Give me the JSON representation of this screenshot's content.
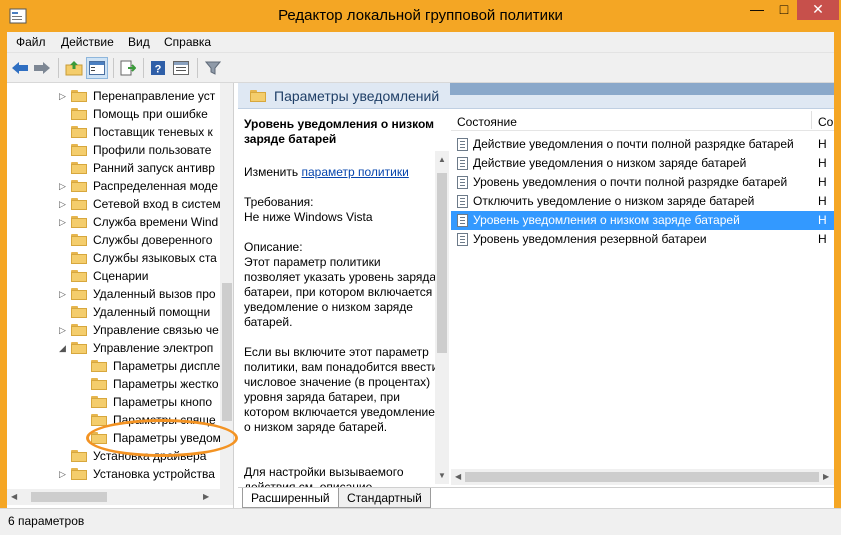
{
  "window": {
    "title": "Редактор локальной групповой политики",
    "controls": {
      "minimize": "—",
      "maximize": "□",
      "close": "✕"
    }
  },
  "menu": [
    "Файл",
    "Действие",
    "Вид",
    "Справка"
  ],
  "toolbar": {
    "buttons": [
      "back-icon",
      "forward-icon",
      "up-folder-icon",
      "show-hide-tree-icon",
      "export-list-icon",
      "help-icon",
      "properties-icon",
      "filter-icon"
    ]
  },
  "tree": {
    "items": [
      {
        "label": "Перенаправление уст",
        "indent": 1,
        "arrow": "▷"
      },
      {
        "label": "Помощь при ошибке",
        "indent": 1,
        "arrow": ""
      },
      {
        "label": "Поставщик теневых к",
        "indent": 1,
        "arrow": ""
      },
      {
        "label": "Профили пользовате",
        "indent": 1,
        "arrow": ""
      },
      {
        "label": "Ранний запуск антивр",
        "indent": 1,
        "arrow": ""
      },
      {
        "label": "Распределенная моде",
        "indent": 1,
        "arrow": "▷"
      },
      {
        "label": "Сетевой вход в систем",
        "indent": 1,
        "arrow": "▷"
      },
      {
        "label": "Служба времени Wind",
        "indent": 1,
        "arrow": "▷"
      },
      {
        "label": "Службы доверенного",
        "indent": 1,
        "arrow": ""
      },
      {
        "label": "Службы языковых ста",
        "indent": 1,
        "arrow": ""
      },
      {
        "label": "Сценарии",
        "indent": 1,
        "arrow": ""
      },
      {
        "label": "Удаленный вызов про",
        "indent": 1,
        "arrow": "▷"
      },
      {
        "label": "Удаленный помощни",
        "indent": 1,
        "arrow": ""
      },
      {
        "label": "Управление связью че",
        "indent": 1,
        "arrow": "▷"
      },
      {
        "label": "Управление электроп",
        "indent": 1,
        "arrow": "◢"
      },
      {
        "label": "Параметры диспле",
        "indent": 2,
        "arrow": ""
      },
      {
        "label": "Параметры жестко",
        "indent": 2,
        "arrow": ""
      },
      {
        "label": "Параметры кнопо",
        "indent": 2,
        "arrow": ""
      },
      {
        "label": "Параметры спяще",
        "indent": 2,
        "arrow": ""
      },
      {
        "label": "Параметры уведом",
        "indent": 2,
        "arrow": ""
      },
      {
        "label": "Установка драйвера",
        "indent": 1,
        "arrow": ""
      },
      {
        "label": "Установка устройства",
        "indent": 1,
        "arrow": "▷"
      }
    ]
  },
  "header": {
    "title": "Параметры уведомлений"
  },
  "description": {
    "title": "Уровень уведомления о низком заряде батарей",
    "edit_prefix": "Изменить ",
    "edit_link": "параметр политики",
    "requirements": "Требования:\nНе ниже Windows Vista",
    "desc_label": "Описание:",
    "desc_text": "Этот параметр политики позволяет указать уровень заряда батареи, при котором включается уведомление о низком заряде батарей.",
    "desc_text2": "Если вы включите этот параметр политики, вам понадобится ввести числовое значение (в процентах) уровня заряда батареи, при котором включается уведомление о низком заряде батарей.",
    "desc_text3": "Для настройки вызываемого действия см. описание"
  },
  "list": {
    "col_setting": "Состояние",
    "col_state": "Со",
    "rows": [
      {
        "label": "Действие уведомления о почти полной разрядке батарей",
        "state": "Н"
      },
      {
        "label": "Действие уведомления о низком заряде батарей",
        "state": "Н"
      },
      {
        "label": "Уровень уведомления о почти полной разрядке батарей",
        "state": "Н"
      },
      {
        "label": "Отключить уведомление о низком заряде батарей",
        "state": "Н"
      },
      {
        "label": "Уровень уведомления о низком заряде батарей",
        "state": "Н",
        "selected": true
      },
      {
        "label": "Уровень уведомления резервной батареи",
        "state": "Н"
      }
    ]
  },
  "tabs": {
    "extended": "Расширенный",
    "standard": "Стандартный"
  },
  "status": {
    "text": "6 параметров"
  },
  "colors": {
    "title_bar": "#f4a624",
    "selection": "#3399ff",
    "annotation": "#f39323"
  }
}
